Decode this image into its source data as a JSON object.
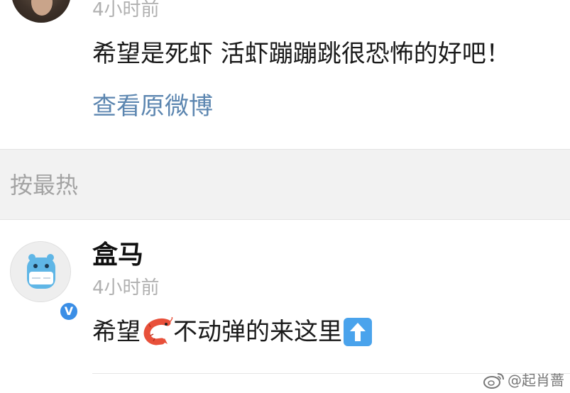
{
  "top_comment": {
    "time": "4小时前",
    "text": "希望是死虾 活虾蹦蹦跳很恐怖的好吧！",
    "view_original_label": "查看原微博"
  },
  "sort": {
    "label": "按最热"
  },
  "comment": {
    "author": "盒马",
    "time": "4小时前",
    "text_part1": "希望",
    "text_part2": "不动弹的来这里",
    "emoji_shrimp": "shrimp-emoji",
    "emoji_up": "up-arrow-emoji",
    "verified_badge": "V"
  },
  "watermark": {
    "text": "@起肖蔷"
  },
  "colors": {
    "link": "#5c86b0",
    "muted": "#b0b0b0",
    "section_bg": "#f2f2f2",
    "verified": "#3a8ee6"
  }
}
